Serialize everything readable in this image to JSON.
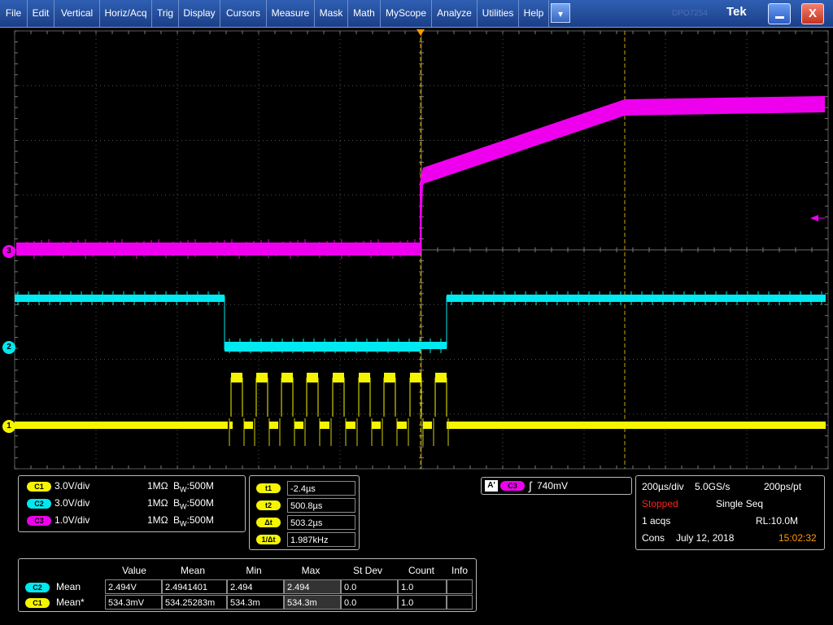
{
  "menu": {
    "items": [
      "File",
      "Edit",
      "Vertical",
      "Horiz/Acq",
      "Trig",
      "Display",
      "Cursors",
      "Measure",
      "Mask",
      "Math",
      "MyScope",
      "Analyze",
      "Utilities",
      "Help"
    ],
    "dropdown_glyph": "▾",
    "brand": "Tek",
    "brand_ghost": "DPO7254",
    "close_glyph": "X"
  },
  "channels": [
    {
      "label": "C1",
      "scale": "3.0V/div",
      "coupling": "1MΩ",
      "bw_prefix": "B",
      "bw_sub": "W",
      "bw_value": ":500M",
      "color": "#f5f500",
      "marker": "1"
    },
    {
      "label": "C2",
      "scale": "3.0V/div",
      "coupling": "1MΩ",
      "bw_prefix": "B",
      "bw_sub": "W",
      "bw_value": ":500M",
      "color": "#00e8f0",
      "marker": "2"
    },
    {
      "label": "C3",
      "scale": "1.0V/div",
      "coupling": "1MΩ",
      "bw_prefix": "B",
      "bw_sub": "W",
      "bw_value": ":500M",
      "color": "#ee00ee",
      "marker": "3"
    }
  ],
  "cursors": {
    "rows": [
      {
        "label": "t1",
        "value": "-2.4µs"
      },
      {
        "label": "t2",
        "value": "500.8µs"
      },
      {
        "label": "Δt",
        "value": "503.2µs"
      },
      {
        "label": "1/Δt",
        "value": "1.987kHz"
      }
    ]
  },
  "trigger": {
    "mode": "A'",
    "source": "C3",
    "edge_glyph": "∫",
    "level": "740mV"
  },
  "acquisition": {
    "timebase": "200µs/div",
    "sample_rate": "5.0GS/s",
    "resolution": "200ps/pt",
    "state": "Stopped",
    "mode": "Single Seq",
    "acqs": "1 acqs",
    "record_length": "RL:10.0M",
    "cons": "Cons",
    "date": "July 12, 2018",
    "time": "15:02:32"
  },
  "measurements": {
    "headers": [
      "Value",
      "Mean",
      "Min",
      "Max",
      "St Dev",
      "Count",
      "Info"
    ],
    "rows": [
      {
        "source": "C2",
        "name": "Mean",
        "value": "2.494V",
        "mean": "2.4941401",
        "min": "2.494",
        "max": "2.494",
        "stdev": "0.0",
        "count": "1.0",
        "info": ""
      },
      {
        "source": "C1",
        "name": "Mean*",
        "value": "534.3mV",
        "mean": "534.25283m",
        "min": "534.3m",
        "max": "534.3m",
        "stdev": "0.0",
        "count": "1.0",
        "info": ""
      }
    ]
  },
  "colors": {
    "ch1": "#f5f500",
    "ch2": "#00e8f0",
    "ch3": "#ee00ee",
    "stopped": "#ff2020",
    "time": "#ff9900",
    "cursor": "#c8a800"
  },
  "icons": [
    "dropdown-arrow-icon",
    "minimize-icon",
    "close-icon",
    "trigger-position-icon",
    "trigger-level-icon",
    "rising-edge-icon"
  ]
}
